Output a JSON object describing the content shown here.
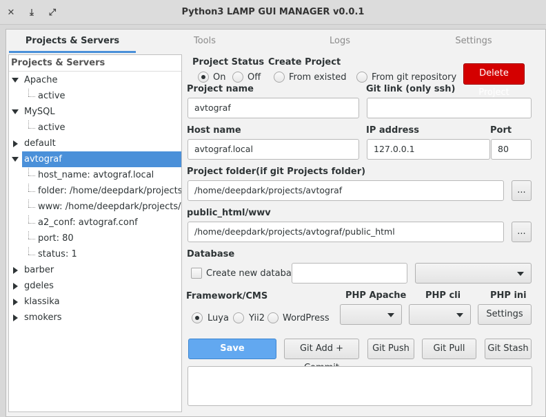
{
  "window": {
    "title": "Python3 LAMP GUI MANAGER v0.0.1",
    "controls": {
      "close": "✕",
      "minimize": "⤓",
      "maximize": "⤢"
    }
  },
  "tabs": [
    {
      "label": "Projects & Servers",
      "active": true
    },
    {
      "label": "Tools"
    },
    {
      "label": "Logs"
    },
    {
      "label": "Settings"
    }
  ],
  "tree": {
    "header": "Projects & Servers",
    "items": [
      {
        "label": "Apache",
        "expander": "down"
      },
      {
        "label": "active"
      },
      {
        "label": "MySQL",
        "expander": "down"
      },
      {
        "label": "active"
      },
      {
        "label": "default",
        "expander": "right"
      },
      {
        "label": "avtograf",
        "expander": "down",
        "selected": true
      },
      {
        "label": "host_name: avtograf.local"
      },
      {
        "label": "folder: /home/deepdark/projects/a..."
      },
      {
        "label": "www: /home/deepdark/projects/av..."
      },
      {
        "label": "a2_conf: avtograf.conf"
      },
      {
        "label": "port: 80"
      },
      {
        "label": "status: 1"
      },
      {
        "label": "barber",
        "expander": "right"
      },
      {
        "label": "gdeles",
        "expander": "right"
      },
      {
        "label": "klassika",
        "expander": "right"
      },
      {
        "label": "smokers",
        "expander": "right"
      }
    ]
  },
  "form": {
    "project_status": {
      "label": "Project Status",
      "options": [
        {
          "label": "On",
          "checked": true
        },
        {
          "label": "Off",
          "checked": false
        }
      ]
    },
    "create_project": {
      "label": "Create Project",
      "options": [
        {
          "label": "From existed",
          "checked": false
        },
        {
          "label": "From git repository",
          "checked": false
        }
      ]
    },
    "delete_button": "Delete Project",
    "project_name": {
      "label": "Project name",
      "value": "avtograf"
    },
    "git_link": {
      "label": "Git link (only ssh)",
      "value": ""
    },
    "host_name": {
      "label": "Host name",
      "value": "avtograf.local"
    },
    "ip_address": {
      "label": "IP address",
      "value": "127.0.0.1"
    },
    "port": {
      "label": "Port",
      "value": "80"
    },
    "project_folder": {
      "label": "Project folder(if git Projects folder)",
      "value": "/home/deepdark/projects/avtograf",
      "browse": "..."
    },
    "public_html": {
      "label": "public_html/wwv",
      "value": "/home/deepdark/projects/avtograf/public_html",
      "browse": "..."
    },
    "database": {
      "label": "Database",
      "create_new_label": "Create new database",
      "checked": false,
      "name_value": ""
    },
    "framework": {
      "label": "Framework/CMS",
      "options": [
        {
          "label": "Luya",
          "checked": true
        },
        {
          "label": "Yii2",
          "checked": false
        },
        {
          "label": "WordPress",
          "checked": false
        }
      ]
    },
    "php_apache": {
      "label": "PHP Apache"
    },
    "php_cli": {
      "label": "PHP cli"
    },
    "php_ini": {
      "label": "PHP ini",
      "button": "Settings"
    },
    "actions": {
      "save": "Save",
      "git_add_commit": "Git Add + Commit",
      "git_push": "Git Push",
      "git_pull": "Git Pull",
      "git_stash": "Git Stash"
    },
    "log_output": ""
  },
  "colors": {
    "accent": "#4a90d9",
    "primary_button": "#62a8f0",
    "danger_button": "#d40000"
  }
}
